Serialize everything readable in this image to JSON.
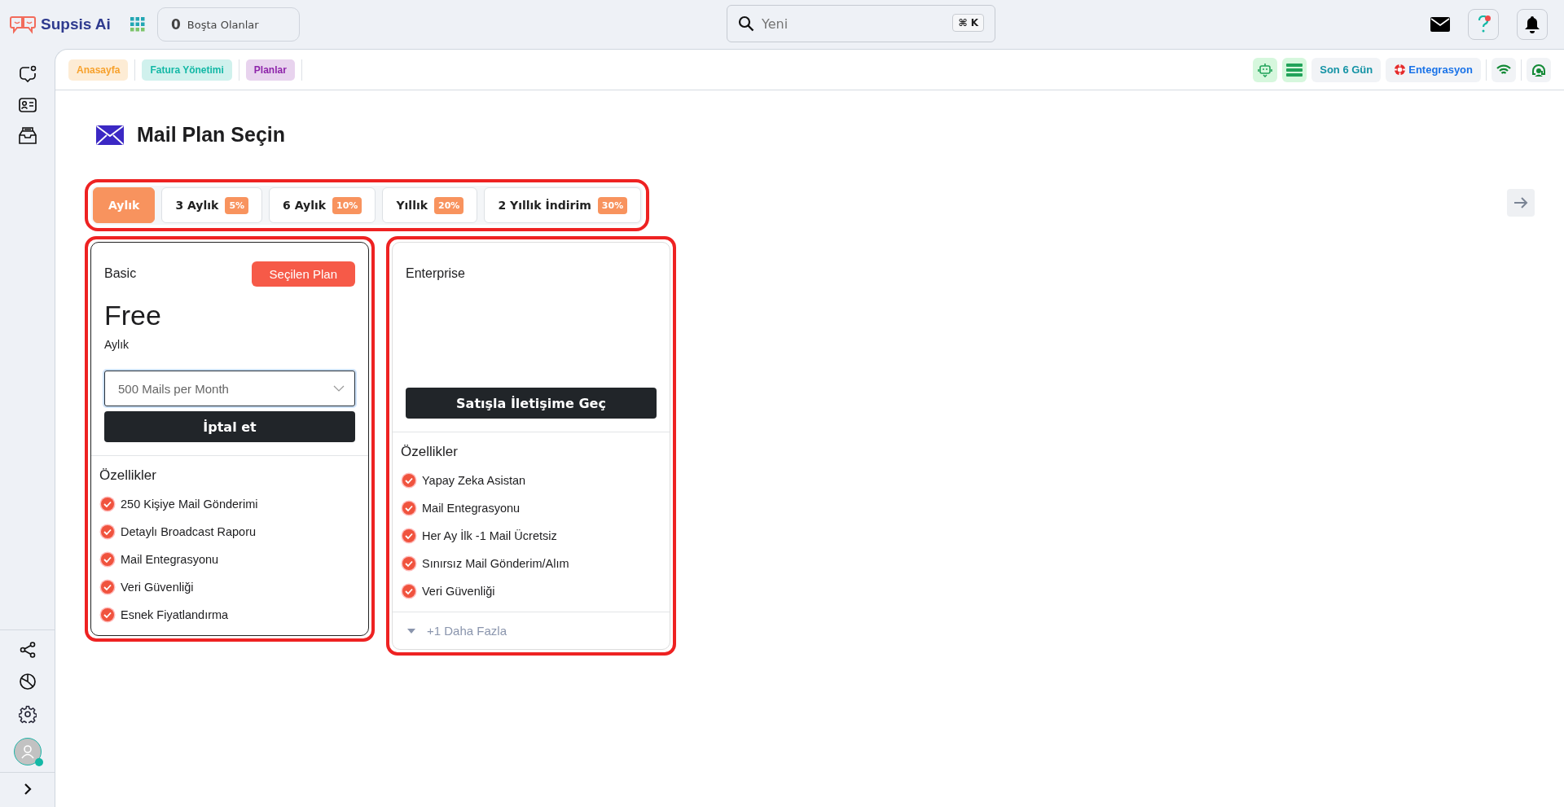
{
  "brand": {
    "name": "Supsis Ai"
  },
  "idle": {
    "count": "0",
    "label": "Boşta Olanlar"
  },
  "search": {
    "placeholder": "Yeni",
    "shortcut": "⌘ K"
  },
  "breadcrumbs": [
    {
      "label": "Anasayfa",
      "color": "#f7a12c"
    },
    {
      "label": "Fatura Yönetimi",
      "color": "#14b8a6"
    },
    {
      "label": "Planlar",
      "color": "#8e24aa"
    }
  ],
  "toolbar": {
    "range": "Son 6 Gün",
    "integration": "Entegrasyon"
  },
  "page_title": "Mail Plan Seçin",
  "tabs": [
    {
      "label": "Aylık",
      "selected": true
    },
    {
      "label": "3 Aylık",
      "badge": "5%",
      "selected": false
    },
    {
      "label": "6 Aylık",
      "badge": "10%",
      "selected": false
    },
    {
      "label": "Yıllık",
      "badge": "20%",
      "selected": false
    },
    {
      "label": "2 Yıllık İndirim",
      "badge": "30%",
      "selected": false
    }
  ],
  "plans": [
    {
      "name": "Basic",
      "selected": true,
      "selected_label": "Seçilen Plan",
      "price": "Free",
      "period": "Aylık",
      "option": "500 Mails per Month",
      "action": "İptal et",
      "features_title": "Özellikler",
      "features": [
        "250 Kişiye Mail Gönderimi",
        "Detaylı Broadcast Raporu",
        "Mail Entegrasyonu",
        "Veri Güvenliği",
        "Esnek Fiyatlandırma"
      ]
    },
    {
      "name": "Enterprise",
      "selected": false,
      "action": "Satışla İletişime Geç",
      "features_title": "Özellikler",
      "features": [
        "Yapay Zeka Asistan",
        "Mail Entegrasyonu",
        "Her Ay İlk -1 Mail Ücretsiz",
        "Sınırsız Mail Gönderim/Alım",
        "Veri Güvenliği"
      ],
      "more": "+1 Daha Fazla"
    }
  ]
}
